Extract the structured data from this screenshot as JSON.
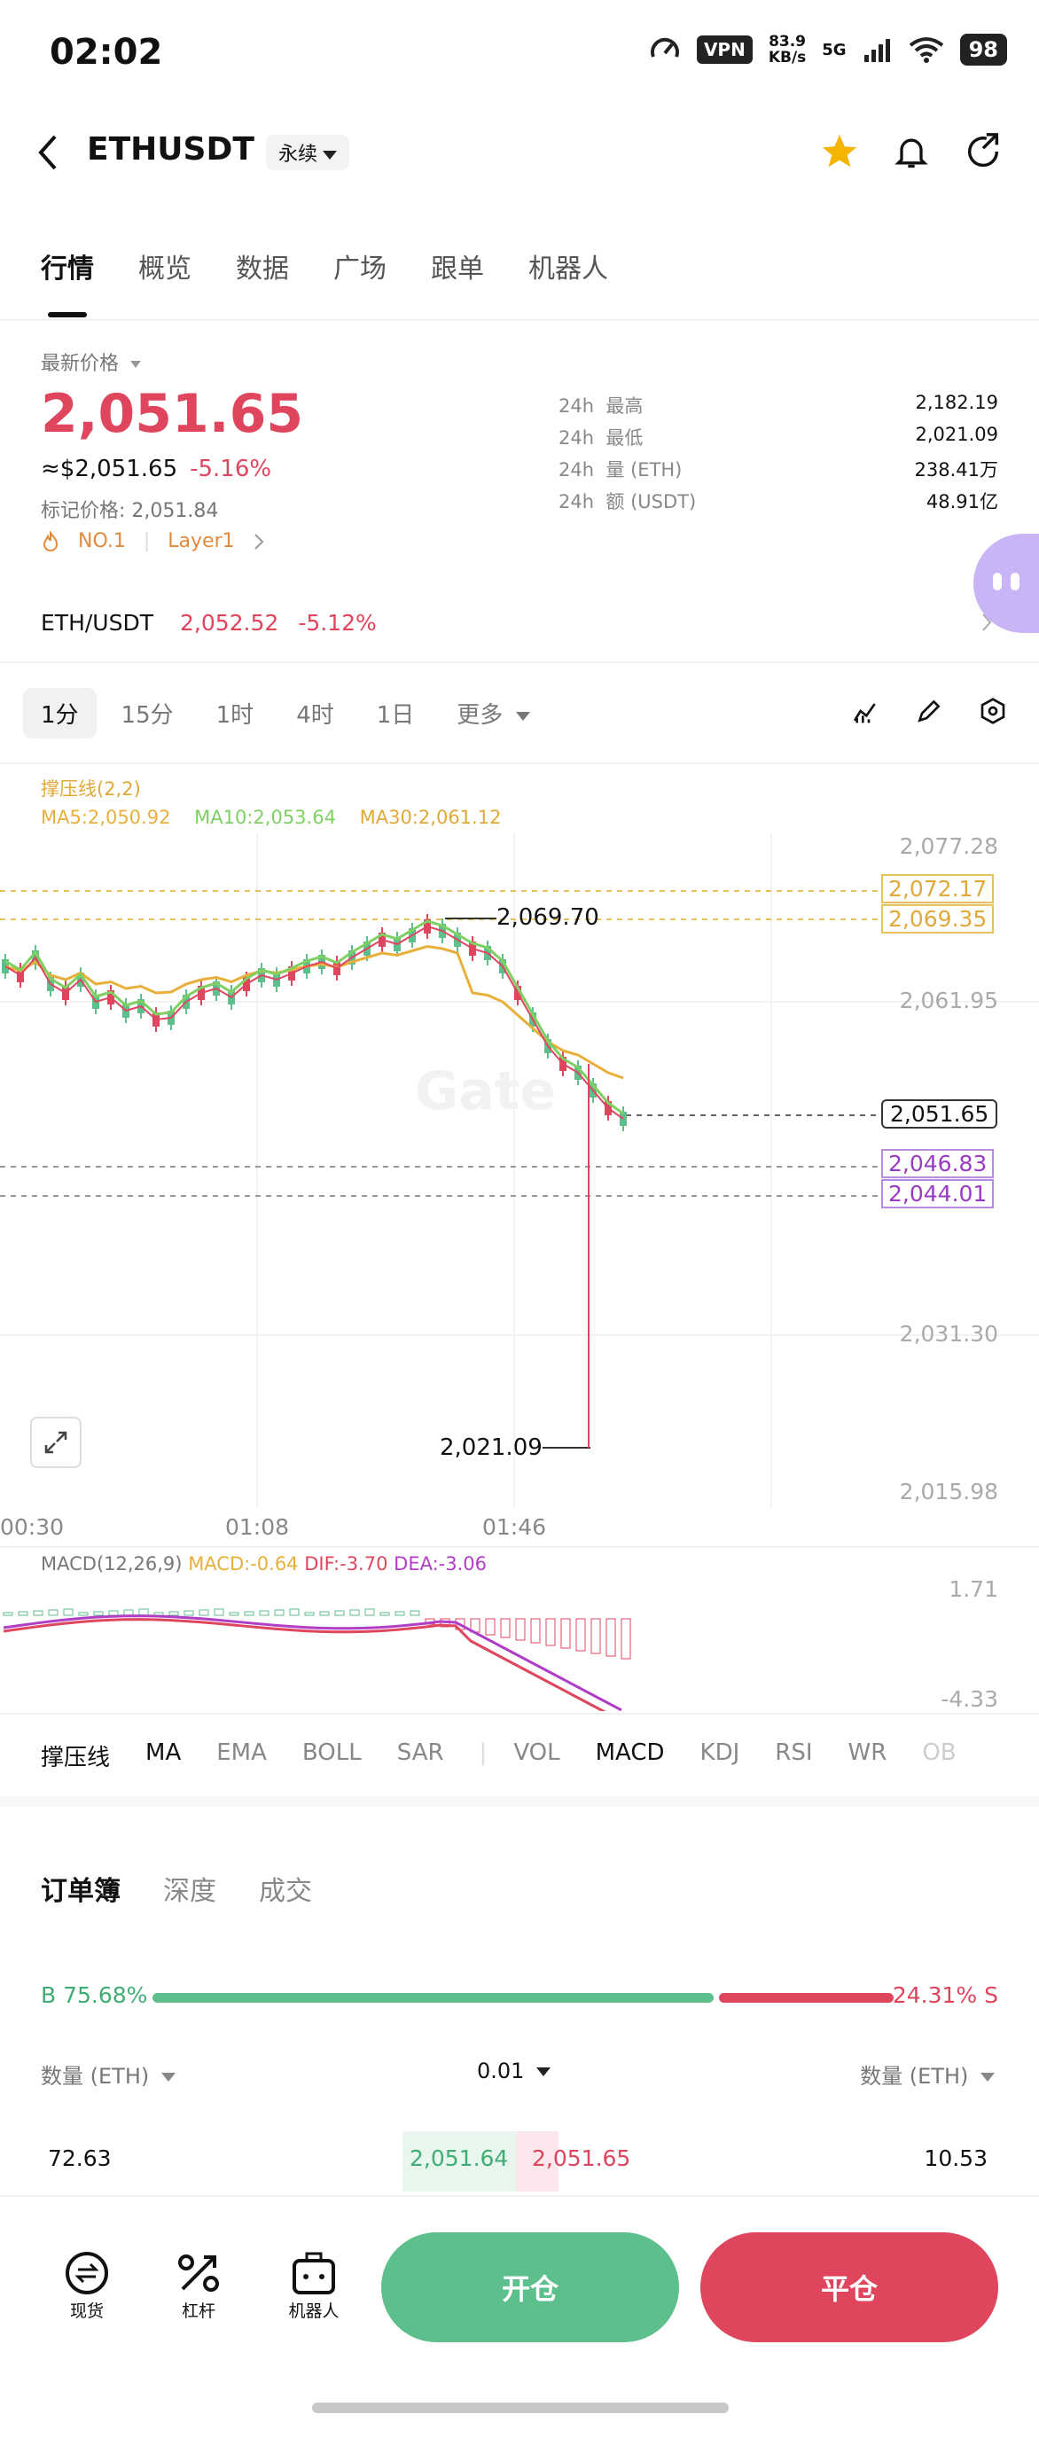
{
  "status_bar": {
    "time": "02:02",
    "vpn": "VPN",
    "speed_value": "83.9",
    "speed_unit": "KB/s",
    "network": "5G",
    "battery": "98"
  },
  "header": {
    "symbol": "ETHUSDT",
    "contract_type": "永续"
  },
  "tabs": [
    "行情",
    "概览",
    "数据",
    "广场",
    "跟单",
    "机器人"
  ],
  "price": {
    "label": "最新价格",
    "last": "2,051.65",
    "usd": "≈$2,051.65",
    "change": "-5.16%",
    "mark": "标记价格: 2,051.84",
    "tag1": "NO.1",
    "tag2": "Layer1"
  },
  "stats_24h": [
    {
      "prefix": "24h",
      "label": "最高",
      "value": "2,182.19"
    },
    {
      "prefix": "24h",
      "label": "最低",
      "value": "2,021.09"
    },
    {
      "prefix": "24h",
      "label": "量 (ETH)",
      "value": "238.41万"
    },
    {
      "prefix": "24h",
      "label": "额 (USDT)",
      "value": "48.91亿"
    }
  ],
  "spot_pair": {
    "name": "ETH/USDT",
    "price": "2,052.52",
    "change": "-5.12%"
  },
  "timeframes": [
    "1分",
    "15分",
    "1时",
    "4时",
    "1日",
    "更多"
  ],
  "chart": {
    "pressure_label": "撑压线(2,2)",
    "ma5": "MA5:2,050.92",
    "ma10": "MA10:2,053.64",
    "ma30": "MA30:2,061.12",
    "y_ticks": [
      "2,077.28",
      "2,061.95",
      "2,031.30",
      "2,015.98"
    ],
    "x_ticks": [
      "00:30",
      "01:08",
      "01:46"
    ],
    "high_label": "2,069.70",
    "low_label": "2,021.09",
    "tags": {
      "current": "2,051.65",
      "r1": "2,072.17",
      "r2": "2,069.35",
      "s1": "2,046.83",
      "s2": "2,044.01"
    },
    "macd_header": "MACD(12,26,9)",
    "macd_val": "MACD:-0.64",
    "dif": "DIF:-3.70",
    "dea": "DEA:-3.06",
    "macd_y_top": "1.71",
    "macd_y_bottom": "-4.33",
    "colors": {
      "up": "#5dbf8c",
      "down": "#e0455e",
      "ma5": "#e8b03a",
      "ma10": "#7fd063",
      "ma30": "#e0a93a",
      "dif": "#b03ec7",
      "dea": "#e0455e"
    }
  },
  "indicator_tabs": [
    "撑压线",
    "MA",
    "EMA",
    "BOLL",
    "SAR",
    "VOL",
    "MACD",
    "KDJ",
    "RSI",
    "WR",
    "OB"
  ],
  "orderbook": {
    "tabs": [
      "订单簿",
      "深度",
      "成交"
    ],
    "buy_ratio": "B 75.68%",
    "sell_ratio": "24.31% S",
    "buy_fraction": 0.7568,
    "qty_left": "数量 (ETH)",
    "precision": "0.01",
    "qty_right": "数量 (ETH)",
    "row": {
      "bid_qty": "72.63",
      "bid_price": "2,051.64",
      "ask_price": "2,051.65",
      "ask_qty": "10.53"
    }
  },
  "bottom_nav": [
    {
      "label": "现货",
      "icon": "spot-icon"
    },
    {
      "label": "杠杆",
      "icon": "leverage-icon"
    },
    {
      "label": "机器人",
      "icon": "robot-icon"
    }
  ],
  "actions": {
    "open": "开仓",
    "close": "平仓"
  }
}
